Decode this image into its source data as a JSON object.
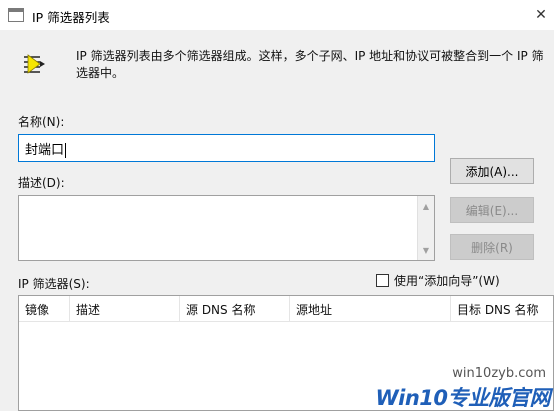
{
  "window": {
    "title": "IP 筛选器列表",
    "close_glyph": "✕"
  },
  "description": "IP 筛选器列表由多个筛选器组成。这样，多个子网、IP 地址和协议可被整合到一个 IP 筛选器中。",
  "name_field": {
    "label": "名称(N):",
    "value": "封端口"
  },
  "desc_field": {
    "label": "描述(D):",
    "value": ""
  },
  "buttons": {
    "add": "添加(A)...",
    "edit": "编辑(E)...",
    "delete": "删除(R)"
  },
  "filters": {
    "label": "IP 筛选器(S):",
    "wizard_checkbox": "使用“添加向导”(W)",
    "wizard_checked": false,
    "columns": [
      "镜像",
      "描述",
      "源 DNS 名称",
      "源地址",
      "目标 DNS 名称"
    ],
    "rows": []
  },
  "watermark": {
    "url": "win10zyb.com",
    "brand": "Win10专业版官网"
  },
  "icons": {
    "app": "window-icon",
    "filter": "ip-filter-icon",
    "scroll_up": "▲",
    "scroll_down": "▼"
  }
}
